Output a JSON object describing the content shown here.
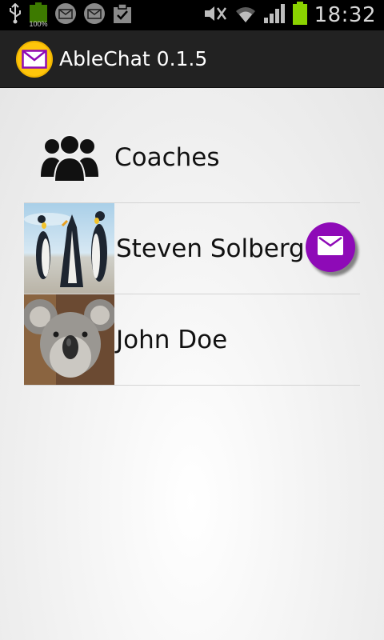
{
  "status_bar": {
    "battery_small_label": "100%",
    "time": "18:32",
    "icons": [
      "usb-icon",
      "battery-icon",
      "mail-notification-icon",
      "mail-notification-icon",
      "clipboard-check-icon",
      "mute-icon",
      "wifi-icon",
      "signal-icon",
      "battery-icon"
    ]
  },
  "app_bar": {
    "title": "AbleChat 0.1.5",
    "icon": "mail-icon",
    "accent": "#ffc60b"
  },
  "group": {
    "label": "Coaches",
    "icon": "group-icon"
  },
  "contacts": [
    {
      "name": "Steven Solberg",
      "avatar": "penguins-photo",
      "has_message": true
    },
    {
      "name": "John Doe",
      "avatar": "koala-photo",
      "has_message": false
    }
  ],
  "colors": {
    "message_badge": "#8e0ab7",
    "battery_green": "#8bd300"
  }
}
